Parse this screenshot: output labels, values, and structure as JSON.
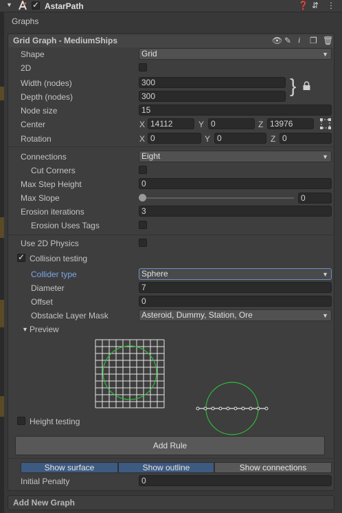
{
  "header": {
    "title": "AstarPath",
    "enabled": true
  },
  "graphs_label": "Graphs",
  "graph": {
    "title": "Grid Graph - MediumShips",
    "shape": {
      "label": "Shape",
      "value": "Grid"
    },
    "is2d": {
      "label": "2D"
    },
    "width": {
      "label": "Width (nodes)",
      "value": "300"
    },
    "depth": {
      "label": "Depth (nodes)",
      "value": "300"
    },
    "node_size": {
      "label": "Node size",
      "value": "15"
    },
    "center": {
      "label": "Center",
      "x_label": "X",
      "x": "14112",
      "y_label": "Y",
      "y": "0",
      "z_label": "Z",
      "z": "13976"
    },
    "rotation": {
      "label": "Rotation",
      "x_label": "X",
      "x": "0",
      "y_label": "Y",
      "y": "0",
      "z_label": "Z",
      "z": "0"
    },
    "connections": {
      "label": "Connections",
      "value": "Eight"
    },
    "cut_corners": {
      "label": "Cut Corners"
    },
    "max_step_height": {
      "label": "Max Step Height",
      "value": "0"
    },
    "max_slope": {
      "label": "Max Slope",
      "value": "0",
      "fraction": 0
    },
    "erosion_iterations": {
      "label": "Erosion iterations",
      "value": "3"
    },
    "erosion_uses_tags": {
      "label": "Erosion Uses Tags"
    },
    "use_2d_physics": {
      "label": "Use 2D Physics"
    },
    "collision_testing": {
      "label": "Collision testing",
      "checked": true
    },
    "collider_type": {
      "label": "Collider type",
      "value": "Sphere"
    },
    "diameter": {
      "label": "Diameter",
      "value": "7"
    },
    "offset": {
      "label": "Offset",
      "value": "0"
    },
    "obstacle_layer_mask": {
      "label": "Obstacle Layer Mask",
      "value": "Asteroid, Dummy, Station, Ore"
    },
    "preview": {
      "label": "Preview"
    },
    "height_testing": {
      "label": "Height testing",
      "checked": false
    },
    "add_rule": "Add Rule",
    "show_surface": "Show surface",
    "show_outline": "Show outline",
    "show_connections": "Show connections",
    "initial_penalty": {
      "label": "Initial Penalty",
      "value": "0"
    }
  },
  "add_new_graph": "Add New Graph",
  "colors": {
    "accent_blue": "#7aa6e6",
    "circle_green": "#2fbf3a"
  }
}
